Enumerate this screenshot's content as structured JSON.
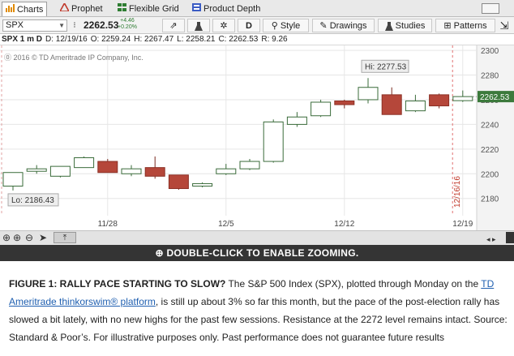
{
  "tabs": [
    {
      "label": "Charts",
      "active": true,
      "icon": "bar-chart-icon"
    },
    {
      "label": "Prophet",
      "active": false,
      "icon": "triangle-icon"
    },
    {
      "label": "Flexible Grid",
      "active": false,
      "icon": "grid-icon"
    },
    {
      "label": "Product Depth",
      "active": false,
      "icon": "depth-icon"
    }
  ],
  "toolbar": {
    "symbol": "SPX",
    "last_price": "2262.53",
    "change": "+4.46",
    "change_pct": "+0.20%",
    "aggregation": "D",
    "style_label": "Style",
    "drawings_label": "Drawings",
    "studies_label": "Studies",
    "patterns_label": "Patterns"
  },
  "infobar": {
    "title": "SPX 1 m D",
    "date": "D: 12/19/16",
    "open": "O: 2259.24",
    "high": "H: 2267.47",
    "low": "L: 2258.21",
    "close": "C: 2262.53",
    "range": "R: 9.26"
  },
  "copyright": "2016 © TD Ameritrade IP Company, Inc.",
  "chart_data": {
    "type": "candlestick",
    "title": "SPX 1 m D",
    "x_tick_labels": [
      "11/28",
      "12/5",
      "12/12",
      "12/19"
    ],
    "y_tick_labels": [
      "2180",
      "2200",
      "2220",
      "2240",
      "2260",
      "2280",
      "2300"
    ],
    "ylim": [
      2166,
      2304
    ],
    "date_marker": "12/16/16",
    "current_price_label": "2262.53",
    "hi_label": "Hi: 2277.53",
    "lo_label": "Lo: 2186.43",
    "grid": true,
    "colors": {
      "up": "#ffffff",
      "down": "#b5473a",
      "outline": "#3a6b3a",
      "gridline": "#e6e6e6",
      "price_tag": "#3c7a3c"
    },
    "candles": [
      {
        "open": 2190,
        "high": 2201,
        "low": 2186.43,
        "close": 2201
      },
      {
        "open": 2202,
        "high": 2207,
        "low": 2200,
        "close": 2204
      },
      {
        "open": 2198,
        "high": 2206,
        "low": 2197,
        "close": 2206
      },
      {
        "open": 2205,
        "high": 2214,
        "low": 2205,
        "close": 2213
      },
      {
        "open": 2210,
        "high": 2212,
        "low": 2201,
        "close": 2201
      },
      {
        "open": 2200,
        "high": 2207,
        "low": 2198,
        "close": 2204
      },
      {
        "open": 2205,
        "high": 2214,
        "low": 2196,
        "close": 2198
      },
      {
        "open": 2199,
        "high": 2199,
        "low": 2187,
        "close": 2188
      },
      {
        "open": 2190,
        "high": 2193,
        "low": 2189,
        "close": 2192
      },
      {
        "open": 2200,
        "high": 2208,
        "low": 2199,
        "close": 2204
      },
      {
        "open": 2204,
        "high": 2212,
        "low": 2203,
        "close": 2210
      },
      {
        "open": 2210,
        "high": 2244,
        "low": 2209,
        "close": 2242
      },
      {
        "open": 2240,
        "high": 2250,
        "low": 2238,
        "close": 2246
      },
      {
        "open": 2247,
        "high": 2260,
        "low": 2246,
        "close": 2258
      },
      {
        "open": 2259,
        "high": 2260,
        "low": 2253,
        "close": 2256
      },
      {
        "open": 2260,
        "high": 2277.53,
        "low": 2257,
        "close": 2270
      },
      {
        "open": 2264,
        "high": 2270,
        "low": 2249,
        "close": 2248
      },
      {
        "open": 2251,
        "high": 2264,
        "low": 2250,
        "close": 2259
      },
      {
        "open": 2264,
        "high": 2265,
        "low": 2253,
        "close": 2255
      },
      {
        "open": 2259.24,
        "high": 2267.47,
        "low": 2258.21,
        "close": 2262.53
      }
    ]
  },
  "controls": {
    "zoom_banner": "DOUBLE-CLICK TO ENABLE ZOOMING."
  },
  "caption": {
    "title": "FIGURE 1: RALLY PACE STARTING TO SLOW?",
    "part1": " The S&P 500 Index (SPX), plotted through Monday on the ",
    "link": "TD Ameritrade thinkorswim® platform",
    "part2": ", is still up about 3% so far this month, but the pace of the post-election rally has slowed a bit lately, with no new highs for the past few sessions. Resistance at the 2272 level remains intact. Source: Standard & Poor’s. For illustrative purposes only. Past performance does not guarantee future results"
  }
}
